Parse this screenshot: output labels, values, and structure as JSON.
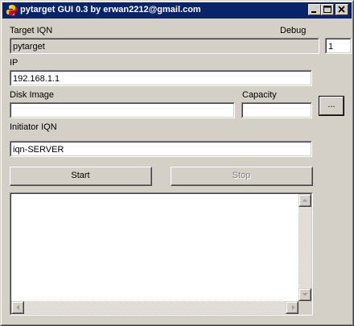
{
  "window": {
    "title": "pytarget GUI 0.3 by erwan2212@gmail.com",
    "icon": "python-icon"
  },
  "titlebar_buttons": {
    "minimize": "minimize-icon",
    "maximize": "maximize-icon",
    "close": "close-icon"
  },
  "form": {
    "target_iqn_label": "Target IQN",
    "target_iqn_value": "pytarget",
    "debug_label": "Debug",
    "debug_value": "1",
    "ip_label": "IP",
    "ip_value": "192.168.1.1",
    "disk_image_label": "Disk Image",
    "disk_image_value": "",
    "capacity_label": "Capacity",
    "capacity_value": "",
    "browse_label": "...",
    "initiator_iqn_label": "Initiator IQN",
    "initiator_iqn_value": "iqn-SERVER"
  },
  "actions": {
    "start_label": "Start",
    "stop_label": "Stop",
    "stop_enabled": false
  },
  "log": {
    "content": ""
  }
}
